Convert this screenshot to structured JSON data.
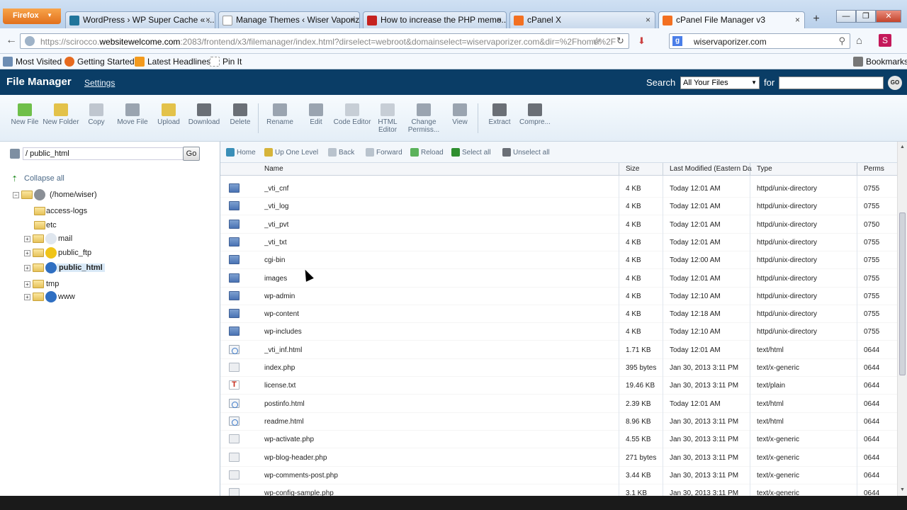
{
  "browser": {
    "firefox_button": "Firefox",
    "tabs": [
      {
        "label": "WordPress › WP Super Cache « ...",
        "close": "×",
        "icon_color": "#21759b",
        "icon": "wordpress-icon"
      },
      {
        "label": "Manage Themes ‹ Wiser Vaporiz...",
        "close": "×",
        "icon_color": "#ffffff",
        "icon": "blank-page-icon"
      },
      {
        "label": "How to increase the PHP memo...",
        "close": "×",
        "icon_color": "#c5221f",
        "icon": "gmail-icon"
      },
      {
        "label": "cPanel X",
        "close": "×",
        "icon_color": "#f37021",
        "icon": "cpanel-icon"
      },
      {
        "label": "cPanel File Manager v3",
        "close": "×",
        "icon_color": "#f37021",
        "icon": "cpanel-icon"
      }
    ],
    "new_tab": "+",
    "window_buttons": {
      "minimize": "—",
      "restore": "❐",
      "close": "✕"
    },
    "url_prefix": "https://scirocco.",
    "url_domain": "websitewelcome.com",
    "url_rest": ":2083/frontend/x3/filemanager/index.html?dirselect=webroot&domainselect=wiservaporizer.com&dir=%2Fhome%2F",
    "search_engine_value": "wiservaporizer.com",
    "bookmarks": [
      "Most Visited",
      "Getting Started",
      "Latest Headlines",
      "Pin It"
    ],
    "bookmarks_menu": "Bookmarks"
  },
  "header": {
    "title": "File Manager",
    "settings": "Settings",
    "search_label": "Search",
    "search_scope": "All Your Files",
    "for_label": "for",
    "go": "GO"
  },
  "toolbar": [
    {
      "label": "New File",
      "icon": "new-file-icon",
      "color": "#6fbf4a"
    },
    {
      "label": "New Folder",
      "icon": "new-folder-icon",
      "color": "#e3c24a"
    },
    {
      "label": "Copy",
      "icon": "copy-icon",
      "color": "#bfc6cf"
    },
    {
      "label": "Move File",
      "icon": "move-file-icon",
      "color": "#9aa4b0"
    },
    {
      "label": "Upload",
      "icon": "upload-icon",
      "color": "#e3c24a"
    },
    {
      "label": "Download",
      "icon": "download-icon",
      "color": "#6a6f76"
    },
    {
      "label": "Delete",
      "icon": "delete-icon",
      "color": "#6a6f76"
    },
    {
      "label": "Rename",
      "icon": "rename-icon",
      "color": "#9aa4b0"
    },
    {
      "label": "Edit",
      "icon": "edit-icon",
      "color": "#9aa4b0"
    },
    {
      "label": "Code Editor",
      "icon": "code-editor-icon",
      "color": "#c7ced6"
    },
    {
      "label": "HTML Editor",
      "icon": "html-editor-icon",
      "color": "#c7ced6"
    },
    {
      "label": "Change Permiss...",
      "icon": "change-permissions-icon",
      "color": "#9aa4b0"
    },
    {
      "label": "View",
      "icon": "view-icon",
      "color": "#9aa4b0"
    },
    {
      "label": "Extract",
      "icon": "extract-icon",
      "color": "#6a6f76"
    },
    {
      "label": "Compre...",
      "icon": "compress-icon",
      "color": "#6a6f76"
    }
  ],
  "left": {
    "path_value": "/ public_html",
    "go": "Go",
    "collapse_all": "Collapse all",
    "tree": [
      {
        "label": "(/home/wiser)",
        "icon": "home-icon"
      },
      {
        "label": "access-logs",
        "icon": "folder-icon"
      },
      {
        "label": "etc",
        "icon": "folder-icon"
      },
      {
        "label": "mail",
        "icon": "mail-folder-icon"
      },
      {
        "label": "public_ftp",
        "icon": "ftp-folder-icon"
      },
      {
        "label": "public_html",
        "icon": "globe-folder-icon"
      },
      {
        "label": "tmp",
        "icon": "folder-icon"
      },
      {
        "label": "www",
        "icon": "globe-folder-icon"
      }
    ]
  },
  "nav": [
    {
      "label": "Home",
      "icon": "home-icon",
      "color": "#3a8fb8"
    },
    {
      "label": "Up One Level",
      "icon": "up-level-icon",
      "color": "#d6b43a"
    },
    {
      "label": "Back",
      "icon": "back-icon",
      "color": "#b9c3cd"
    },
    {
      "label": "Forward",
      "icon": "forward-icon",
      "color": "#b9c3cd"
    },
    {
      "label": "Reload",
      "icon": "reload-icon",
      "color": "#5bb25b"
    },
    {
      "label": "Select all",
      "icon": "checkbox-checked-icon",
      "color": "#2f8f2f"
    },
    {
      "label": "Unselect all",
      "icon": "checkbox-empty-icon",
      "color": "#6a6f76"
    }
  ],
  "columns": [
    "Name",
    "Size",
    "Last Modified (Eastern Da",
    "Type",
    "Perms"
  ],
  "files": [
    {
      "name": "_vti_cnf",
      "size": "4 KB",
      "modified": "Today 12:01 AM",
      "type": "httpd/unix-directory",
      "perms": "0755",
      "kind": "dir"
    },
    {
      "name": "_vti_log",
      "size": "4 KB",
      "modified": "Today 12:01 AM",
      "type": "httpd/unix-directory",
      "perms": "0755",
      "kind": "dir"
    },
    {
      "name": "_vti_pvt",
      "size": "4 KB",
      "modified": "Today 12:01 AM",
      "type": "httpd/unix-directory",
      "perms": "0750",
      "kind": "dir"
    },
    {
      "name": "_vti_txt",
      "size": "4 KB",
      "modified": "Today 12:01 AM",
      "type": "httpd/unix-directory",
      "perms": "0755",
      "kind": "dir"
    },
    {
      "name": "cgi-bin",
      "size": "4 KB",
      "modified": "Today 12:00 AM",
      "type": "httpd/unix-directory",
      "perms": "0755",
      "kind": "dir"
    },
    {
      "name": "images",
      "size": "4 KB",
      "modified": "Today 12:01 AM",
      "type": "httpd/unix-directory",
      "perms": "0755",
      "kind": "dir"
    },
    {
      "name": "wp-admin",
      "size": "4 KB",
      "modified": "Today 12:10 AM",
      "type": "httpd/unix-directory",
      "perms": "0755",
      "kind": "dir"
    },
    {
      "name": "wp-content",
      "size": "4 KB",
      "modified": "Today 12:18 AM",
      "type": "httpd/unix-directory",
      "perms": "0755",
      "kind": "dir"
    },
    {
      "name": "wp-includes",
      "size": "4 KB",
      "modified": "Today 12:10 AM",
      "type": "httpd/unix-directory",
      "perms": "0755",
      "kind": "dir"
    },
    {
      "name": "_vti_inf.html",
      "size": "1.71 KB",
      "modified": "Today 12:01 AM",
      "type": "text/html",
      "perms": "0644",
      "kind": "html"
    },
    {
      "name": "index.php",
      "size": "395 bytes",
      "modified": "Jan 30, 2013 3:11 PM",
      "type": "text/x-generic",
      "perms": "0644",
      "kind": "gen"
    },
    {
      "name": "license.txt",
      "size": "19.46 KB",
      "modified": "Jan 30, 2013 3:11 PM",
      "type": "text/plain",
      "perms": "0644",
      "kind": "txt"
    },
    {
      "name": "postinfo.html",
      "size": "2.39 KB",
      "modified": "Today 12:01 AM",
      "type": "text/html",
      "perms": "0644",
      "kind": "html"
    },
    {
      "name": "readme.html",
      "size": "8.96 KB",
      "modified": "Jan 30, 2013 3:11 PM",
      "type": "text/html",
      "perms": "0644",
      "kind": "html"
    },
    {
      "name": "wp-activate.php",
      "size": "4.55 KB",
      "modified": "Jan 30, 2013 3:11 PM",
      "type": "text/x-generic",
      "perms": "0644",
      "kind": "gen"
    },
    {
      "name": "wp-blog-header.php",
      "size": "271 bytes",
      "modified": "Jan 30, 2013 3:11 PM",
      "type": "text/x-generic",
      "perms": "0644",
      "kind": "gen"
    },
    {
      "name": "wp-comments-post.php",
      "size": "3.44 KB",
      "modified": "Jan 30, 2013 3:11 PM",
      "type": "text/x-generic",
      "perms": "0644",
      "kind": "gen"
    },
    {
      "name": "wp-config-sample.php",
      "size": "3.1 KB",
      "modified": "Jan 30, 2013 3:11 PM",
      "type": "text/x-generic",
      "perms": "0644",
      "kind": "gen"
    }
  ]
}
